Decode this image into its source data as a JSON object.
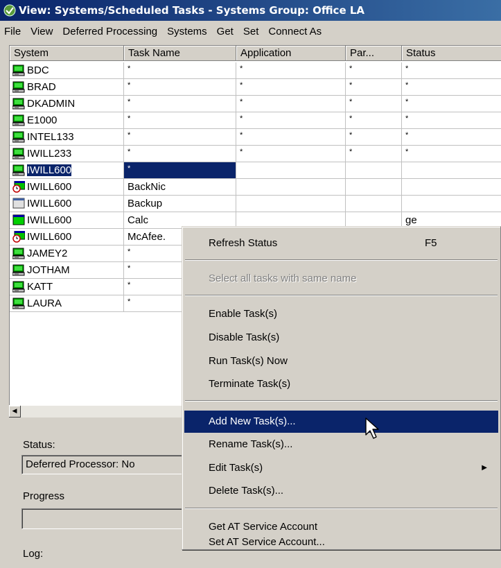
{
  "window": {
    "title": "View: Systems/Scheduled Tasks - Systems Group: Office LA"
  },
  "menubar": {
    "items": [
      "File",
      "View",
      "Deferred Processing",
      "Systems",
      "Get",
      "Set",
      "Connect As"
    ]
  },
  "table": {
    "columns": [
      "System",
      "Task Name",
      "Application",
      "Par...",
      "Status"
    ],
    "rows": [
      {
        "icon": "computer-icon",
        "system": "BDC",
        "task": "*",
        "application": "*",
        "params": "*",
        "status": "*"
      },
      {
        "icon": "computer-icon",
        "system": "BRAD",
        "task": "*",
        "application": "*",
        "params": "*",
        "status": "*"
      },
      {
        "icon": "computer-icon",
        "system": "DKADMIN",
        "task": "*",
        "application": "*",
        "params": "*",
        "status": "*"
      },
      {
        "icon": "computer-icon",
        "system": "E1000",
        "task": "*",
        "application": "*",
        "params": "*",
        "status": "*"
      },
      {
        "icon": "computer-icon",
        "system": "INTEL133",
        "task": "*",
        "application": "*",
        "params": "*",
        "status": "*"
      },
      {
        "icon": "computer-icon",
        "system": "IWILL233",
        "task": "*",
        "application": "*",
        "params": "*",
        "status": "*"
      },
      {
        "icon": "computer-icon",
        "system": "IWILL600",
        "task": "*",
        "application": "",
        "params": "",
        "status": "",
        "selected": true
      },
      {
        "icon": "scheduled-task-clock-icon",
        "system": "IWILL600",
        "task": "BackNic",
        "application": "",
        "params": "",
        "status": ""
      },
      {
        "icon": "task-disabled-icon",
        "system": "IWILL600",
        "task": "Backup",
        "application": "",
        "params": "",
        "status": ""
      },
      {
        "icon": "task-enabled-icon",
        "system": "IWILL600",
        "task": "Calc",
        "application": "",
        "params": "",
        "status": "ge"
      },
      {
        "icon": "scheduled-task-clock-icon",
        "system": "IWILL600",
        "task": "McAfee.",
        "application": "",
        "params": "",
        "status": ""
      },
      {
        "icon": "computer-icon",
        "system": "JAMEY2",
        "task": "*",
        "application": "",
        "params": "",
        "status": ""
      },
      {
        "icon": "computer-icon",
        "system": "JOTHAM",
        "task": "*",
        "application": "",
        "params": "",
        "status": ""
      },
      {
        "icon": "computer-icon",
        "system": "KATT",
        "task": "*",
        "application": "",
        "params": "",
        "status": ""
      },
      {
        "icon": "computer-icon",
        "system": "LAURA",
        "task": "*",
        "application": "",
        "params": "",
        "status": ""
      }
    ]
  },
  "panel": {
    "status_label": "Status:",
    "status_value": "Deferred Processor: No",
    "progress_label": "Progress",
    "log_label": "Log:"
  },
  "context_menu": {
    "items": [
      {
        "label": "Refresh Status",
        "shortcut": "F5"
      },
      {
        "label": "Select all tasks with same name",
        "disabled": true
      },
      {
        "label": "Enable Task(s)"
      },
      {
        "label": "Disable Task(s)"
      },
      {
        "label": "Run Task(s) Now"
      },
      {
        "label": "Terminate Task(s)"
      },
      {
        "label": "Add New Task(s)...",
        "highlighted": true
      },
      {
        "label": "Rename Task(s)..."
      },
      {
        "label": "Edit Task(s)",
        "submenu": true
      },
      {
        "label": "Delete Task(s)..."
      },
      {
        "label": "Get AT Service Account"
      },
      {
        "label": "Set AT Service Account..."
      }
    ]
  },
  "colors": {
    "selection": "#0a246a",
    "face": "#d4d0c8"
  }
}
